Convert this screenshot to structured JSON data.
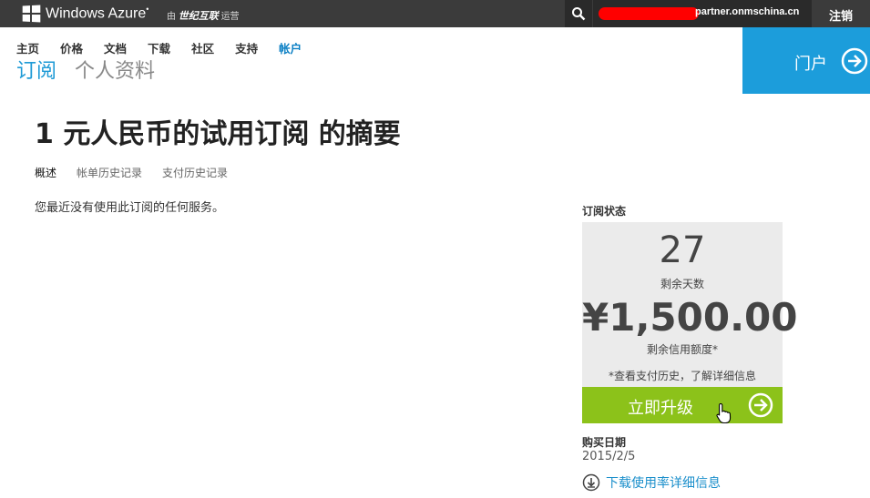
{
  "topbar": {
    "brand": "Windows Azure",
    "brand_mark": "•",
    "partner_prefix": "由",
    "partner_name": "世纪互联",
    "partner_suffix": "运营",
    "user_visible": "partner.onmschina.cn",
    "logout": "注销",
    "colors": {
      "bar": "#3b3b3b",
      "redaction": "#ff0000"
    }
  },
  "nav": {
    "items": [
      {
        "label": "主页"
      },
      {
        "label": "价格"
      },
      {
        "label": "文档"
      },
      {
        "label": "下载"
      },
      {
        "label": "社区"
      },
      {
        "label": "支持"
      },
      {
        "label": "帐户",
        "active": true
      }
    ],
    "sub": [
      {
        "label": "订阅",
        "active": true
      },
      {
        "label": "个人资料"
      }
    ]
  },
  "portal": {
    "label": "门户",
    "icon": "arrow-right-circle-icon",
    "color": "#1c9ddb"
  },
  "main": {
    "title": "1 元人民币的试用订阅 的摘要",
    "tabs": [
      {
        "label": "概述",
        "active": true
      },
      {
        "label": "帐单历史记录"
      },
      {
        "label": "支付历史记录"
      }
    ],
    "message": "您最近没有使用此订阅的任何服务。"
  },
  "status": {
    "heading": "订阅状态",
    "days": "27",
    "days_label": "剩余天数",
    "credit": "¥1,500.00",
    "credit_label": "剩余信用额度*",
    "note": "*查看支付历史，了解详细信息",
    "upgrade_label": "立即升级",
    "upgrade_color": "#8cc21a",
    "purchase_heading": "购买日期",
    "purchase_date": "2015/2/5",
    "download_label": "下载使用率详细信息"
  }
}
